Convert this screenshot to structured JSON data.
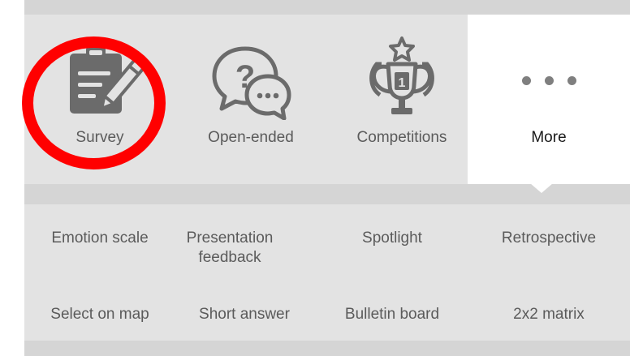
{
  "question_types": {
    "top_row": [
      {
        "id": "survey",
        "label": "Survey",
        "icon": "clipboard-pencil-icon"
      },
      {
        "id": "open-ended",
        "label": "Open-ended",
        "icon": "speech-bubbles-question-icon"
      },
      {
        "id": "competitions",
        "label": "Competitions",
        "icon": "trophy-star-icon"
      },
      {
        "id": "more",
        "label": "More",
        "icon": "more-dots-icon",
        "selected": true
      }
    ],
    "more_options": [
      {
        "label": "Emotion scale"
      },
      {
        "label": "Presentation feedback"
      },
      {
        "label": "Spotlight"
      },
      {
        "label": "Retrospective"
      },
      {
        "label": "Select on map"
      },
      {
        "label": "Short answer"
      },
      {
        "label": "Bulletin board"
      },
      {
        "label": "2x2 matrix"
      }
    ]
  },
  "colors": {
    "tile_background": "#e3e3e3",
    "selected_background": "#ffffff",
    "icon": "#6b6b6b",
    "text": "#5b5b5b",
    "highlight_ring": "#ff0000"
  }
}
